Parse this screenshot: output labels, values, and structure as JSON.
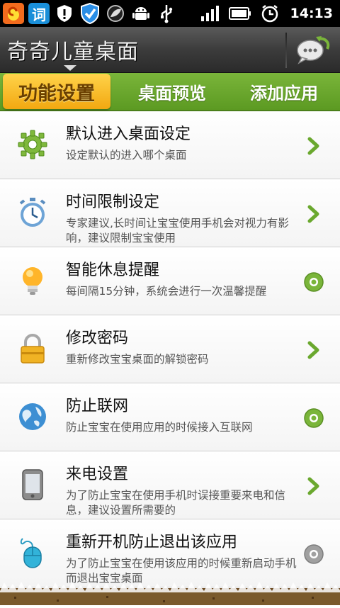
{
  "status_bar": {
    "time": "14:13",
    "left_icons": [
      "app-sun-icon",
      "dictionary-icon",
      "shield-icon",
      "security-check-icon",
      "leaf-icon",
      "android-icon",
      "usb-icon"
    ],
    "right_icons": [
      "signal-icon",
      "battery-icon",
      "alarm-icon"
    ],
    "dictionary_glyph": "词"
  },
  "header": {
    "logo_text": "奇奇儿童桌面",
    "message_button": "message-icon"
  },
  "tabs": [
    {
      "label": "功能设置",
      "active": true
    },
    {
      "label": "桌面预览",
      "active": false
    },
    {
      "label": "添加应用",
      "active": false
    }
  ],
  "items": [
    {
      "title": "默认进入桌面设定",
      "desc": "设定默认的进入哪个桌面",
      "icon": "gear-icon",
      "trailing": "chevron"
    },
    {
      "title": "时间限制设定",
      "desc": "专家建议,长时间让宝宝使用手机会对视力有影响，建议限制宝宝使用",
      "icon": "stopwatch-icon",
      "trailing": "chevron"
    },
    {
      "title": "智能休息提醒",
      "desc": "每间隔15分钟，系统会进行一次温馨提醒",
      "icon": "lightbulb-icon",
      "trailing": "toggle-on"
    },
    {
      "title": "修改密码",
      "desc": "重新修改宝宝桌面的解锁密码",
      "icon": "padlock-icon",
      "trailing": "chevron"
    },
    {
      "title": "防止联网",
      "desc": "防止宝宝在使用应用的时候接入互联网",
      "icon": "globe-icon",
      "trailing": "toggle-on"
    },
    {
      "title": "来电设置",
      "desc": "为了防止宝宝在使用手机时误接重要来电和信息，建议设置所需要的",
      "icon": "phone-icon",
      "trailing": "chevron"
    },
    {
      "title": "重新开机防止退出该应用",
      "desc": "为了防止宝宝在使用该应用的时候重新启动手机而退出宝宝桌面",
      "icon": "mouse-icon",
      "trailing": "toggle-off"
    }
  ],
  "colors": {
    "tab_green": "#6aa82e",
    "active_tab_yellow": "#f8c22b",
    "chevron_green": "#6aa82e",
    "toggle_on": "#7ab53a",
    "toggle_off": "#9a9a9a"
  }
}
